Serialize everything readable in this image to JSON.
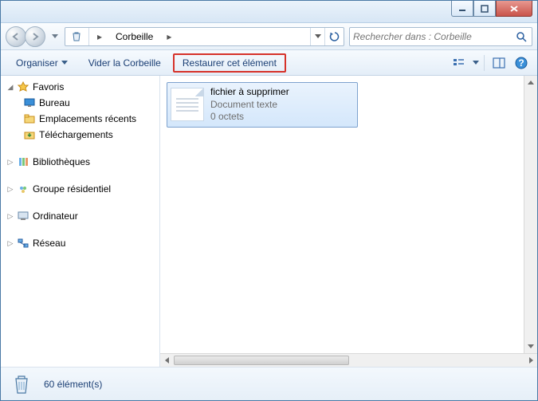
{
  "address": {
    "location": "Corbeille"
  },
  "search": {
    "placeholder": "Rechercher dans : Corbeille"
  },
  "toolbar": {
    "organize": "Organiser",
    "empty": "Vider la Corbeille",
    "restore": "Restaurer cet élément"
  },
  "nav": {
    "favorites": "Favoris",
    "desktop": "Bureau",
    "recent": "Emplacements récents",
    "downloads": "Téléchargements",
    "libraries": "Bibliothèques",
    "homegroup": "Groupe résidentiel",
    "computer": "Ordinateur",
    "network": "Réseau"
  },
  "file": {
    "name": "fichier à supprimer",
    "type": "Document texte",
    "size": "0 octets"
  },
  "status": {
    "count": "60 élément(s)"
  }
}
